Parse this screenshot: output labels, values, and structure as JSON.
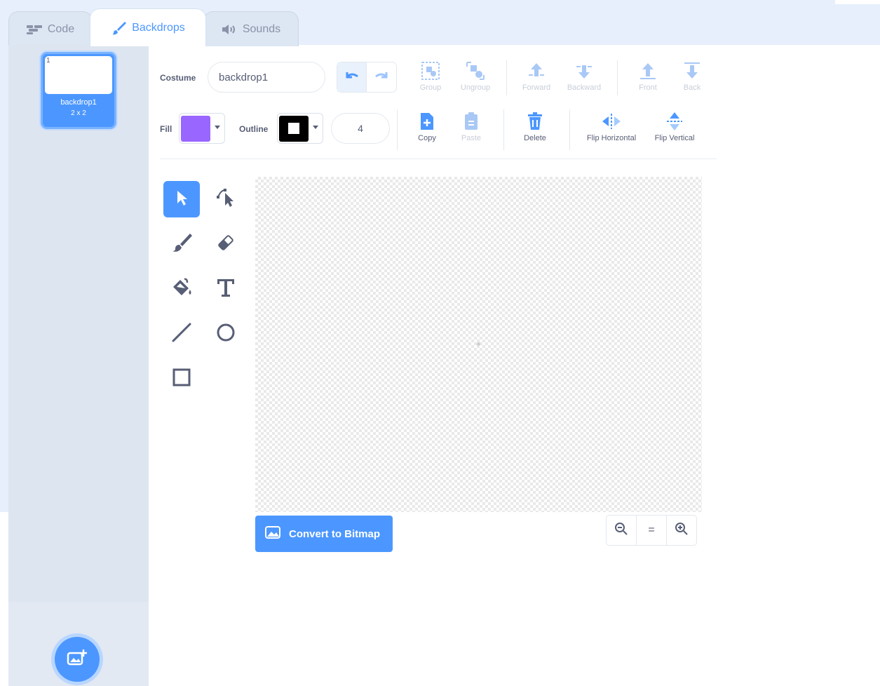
{
  "tabs": [
    {
      "label": "Code",
      "icon": "code-icon"
    },
    {
      "label": "Backdrops",
      "icon": "brush-icon",
      "selected": true
    },
    {
      "label": "Sounds",
      "icon": "speaker-icon"
    }
  ],
  "sidebar": {
    "backdrop": {
      "number": "1",
      "name": "backdrop1",
      "size": "2 x 2"
    },
    "add_button_icon": "add-backdrop-icon"
  },
  "toolbar": {
    "costume_label": "Costume",
    "costume_name": "backdrop1",
    "group_label": "Group",
    "ungroup_label": "Ungroup",
    "forward_label": "Forward",
    "backward_label": "Backward",
    "front_label": "Front",
    "back_label": "Back",
    "fill_label": "Fill",
    "fill_color": "#9966ff",
    "outline_label": "Outline",
    "outline_color": "#000000",
    "outline_width": "4",
    "copy_label": "Copy",
    "paste_label": "Paste",
    "delete_label": "Delete",
    "flip_horizontal_label": "Flip Horizontal",
    "flip_vertical_label": "Flip Vertical"
  },
  "tools": [
    {
      "name": "select-tool",
      "icon": "arrow-icon",
      "selected": true
    },
    {
      "name": "reshape-tool",
      "icon": "reshape-icon"
    },
    {
      "name": "brush-tool",
      "icon": "brush-icon"
    },
    {
      "name": "eraser-tool",
      "icon": "eraser-icon"
    },
    {
      "name": "fill-tool",
      "icon": "fill-bucket-icon"
    },
    {
      "name": "text-tool",
      "icon": "text-icon"
    },
    {
      "name": "line-tool",
      "icon": "line-icon"
    },
    {
      "name": "circle-tool",
      "icon": "circle-icon"
    },
    {
      "name": "rectangle-tool",
      "icon": "rectangle-icon"
    }
  ],
  "canvas": {
    "convert_label": "Convert to Bitmap",
    "zoom_reset_label": "="
  },
  "colors": {
    "accent": "#4c97ff",
    "text": "#575e75",
    "sidebar_bg": "#dde5f1"
  }
}
